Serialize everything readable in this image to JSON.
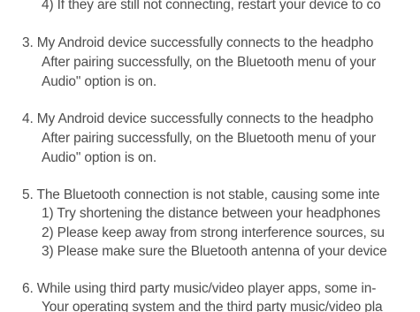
{
  "faq": {
    "item2_partial": {
      "step4": "4) If they are still not connecting, restart your device to co"
    },
    "item3": {
      "text1": "3. My Android device successfully connects to the headpho",
      "text2": "After pairing successfully, on the Bluetooth menu of your",
      "text3": "Audio\" option is on."
    },
    "item4": {
      "text1": "4. My Android device successfully connects to the headpho",
      "text2": "After pairing successfully, on the Bluetooth menu of your",
      "text3": "Audio\" option is on."
    },
    "item5": {
      "text1": "5. The Bluetooth connection is not stable, causing some inte",
      "step1": "1) Try shortening the distance between your headphones",
      "step2": "2) Please keep away from strong interference sources, su",
      "step3": "3) Please make sure the Bluetooth antenna of your device"
    },
    "item6": {
      "text1": "6. While using third party music/video player apps, some in-",
      "text2": "Your operating system and the third party music/video pla"
    }
  }
}
